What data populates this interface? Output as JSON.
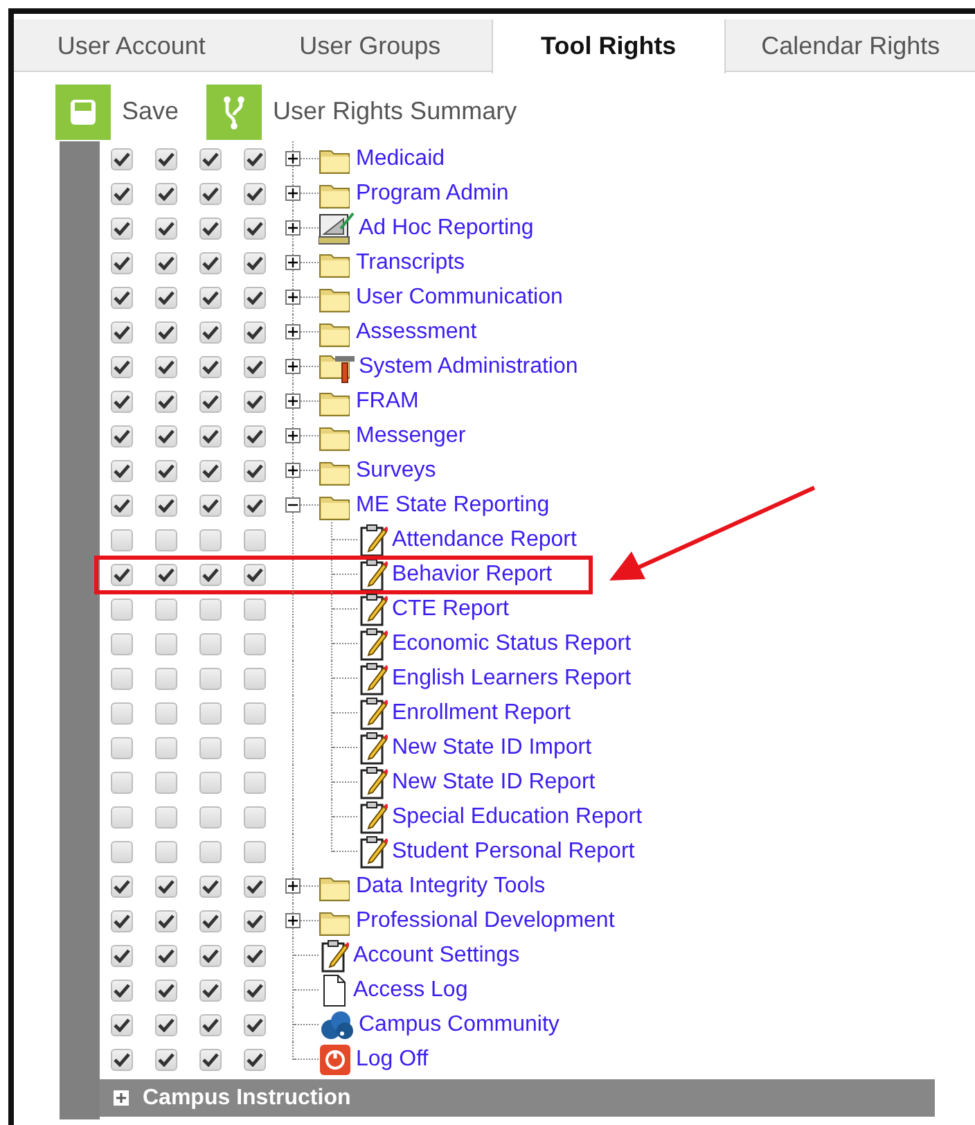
{
  "tabs": [
    {
      "label": "User Account",
      "selected": false
    },
    {
      "label": "User Groups",
      "selected": false
    },
    {
      "label": "Tool Rights",
      "selected": true
    },
    {
      "label": "Calendar Rights",
      "selected": false
    }
  ],
  "toolbar": [
    {
      "label": "Save",
      "kind": "save"
    },
    {
      "label": "User Rights Summary",
      "kind": "summary"
    }
  ],
  "tree": [
    {
      "label": "Medicaid",
      "kind": "folder",
      "expanded": false,
      "checks": [
        true,
        true,
        true,
        true
      ]
    },
    {
      "label": "Program Admin",
      "kind": "folder",
      "expanded": false,
      "checks": [
        true,
        true,
        true,
        true
      ]
    },
    {
      "label": "Ad Hoc Reporting",
      "kind": "adhoc",
      "expanded": false,
      "checks": [
        true,
        true,
        true,
        true
      ]
    },
    {
      "label": "Transcripts",
      "kind": "folder",
      "expanded": false,
      "checks": [
        true,
        true,
        true,
        true
      ]
    },
    {
      "label": "User Communication",
      "kind": "folder",
      "expanded": false,
      "checks": [
        true,
        true,
        true,
        true
      ]
    },
    {
      "label": "Assessment",
      "kind": "folder",
      "expanded": false,
      "checks": [
        true,
        true,
        true,
        true
      ]
    },
    {
      "label": "System Administration",
      "kind": "sysadmin",
      "expanded": false,
      "checks": [
        true,
        true,
        true,
        true
      ]
    },
    {
      "label": "FRAM",
      "kind": "folder",
      "expanded": false,
      "checks": [
        true,
        true,
        true,
        true
      ]
    },
    {
      "label": "Messenger",
      "kind": "folder",
      "expanded": false,
      "checks": [
        true,
        true,
        true,
        true
      ]
    },
    {
      "label": "Surveys",
      "kind": "folder",
      "expanded": false,
      "checks": [
        true,
        true,
        true,
        true
      ]
    },
    {
      "label": "ME State Reporting",
      "kind": "folder",
      "expanded": true,
      "checks": [
        true,
        true,
        true,
        true
      ],
      "children": [
        {
          "label": "Attendance Report",
          "kind": "report",
          "checks": [
            false,
            false,
            false,
            false
          ],
          "highlighted": false
        },
        {
          "label": "Behavior Report",
          "kind": "report",
          "checks": [
            true,
            true,
            true,
            true
          ],
          "highlighted": true
        },
        {
          "label": "CTE Report",
          "kind": "report",
          "checks": [
            false,
            false,
            false,
            false
          ],
          "highlighted": false
        },
        {
          "label": "Economic Status Report",
          "kind": "report",
          "checks": [
            false,
            false,
            false,
            false
          ],
          "highlighted": false
        },
        {
          "label": "English Learners Report",
          "kind": "report",
          "checks": [
            false,
            false,
            false,
            false
          ],
          "highlighted": false
        },
        {
          "label": "Enrollment Report",
          "kind": "report",
          "checks": [
            false,
            false,
            false,
            false
          ],
          "highlighted": false
        },
        {
          "label": "New State ID Import",
          "kind": "report",
          "checks": [
            false,
            false,
            false,
            false
          ],
          "highlighted": false
        },
        {
          "label": "New State ID Report",
          "kind": "report",
          "checks": [
            false,
            false,
            false,
            false
          ],
          "highlighted": false
        },
        {
          "label": "Special Education Report",
          "kind": "report",
          "checks": [
            false,
            false,
            false,
            false
          ],
          "highlighted": false
        },
        {
          "label": "Student Personal Report",
          "kind": "report",
          "checks": [
            false,
            false,
            false,
            false
          ],
          "highlighted": false
        }
      ]
    },
    {
      "label": "Data Integrity Tools",
      "kind": "folder",
      "expanded": false,
      "checks": [
        true,
        true,
        true,
        true
      ]
    },
    {
      "label": "Professional Development",
      "kind": "folder",
      "expanded": false,
      "checks": [
        true,
        true,
        true,
        true
      ]
    },
    {
      "label": "Account Settings",
      "kind": "report",
      "checks": [
        true,
        true,
        true,
        true
      ]
    },
    {
      "label": "Access Log",
      "kind": "page",
      "checks": [
        true,
        true,
        true,
        true
      ]
    },
    {
      "label": "Campus Community",
      "kind": "community",
      "checks": [
        true,
        true,
        true,
        true
      ]
    },
    {
      "label": "Log Off",
      "kind": "logoff",
      "checks": [
        true,
        true,
        true,
        true
      ]
    }
  ],
  "annotation_arrow": true,
  "section": {
    "label": "Campus Instruction",
    "expanded": false
  }
}
